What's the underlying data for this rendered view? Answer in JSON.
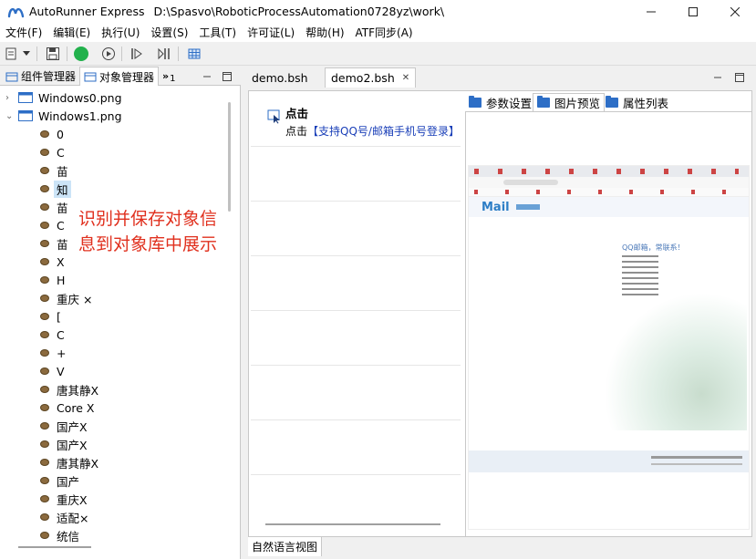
{
  "window": {
    "app_name": "AutoRunner Express",
    "path": "D:\\Spasvo\\RoboticProcessAutomation0728yz\\work\\"
  },
  "menu": [
    "文件(F)",
    "编辑(E)",
    "执行(U)",
    "设置(S)",
    "工具(T)",
    "许可证(L)",
    "帮助(H)",
    "ATF同步(A)"
  ],
  "left_panel": {
    "tabs": [
      "组件管理器",
      "对象管理器"
    ],
    "overflow_count": "1",
    "tree": {
      "roots": [
        "Windows0.png",
        "Windows1.png"
      ],
      "children": [
        "0",
        "C",
        "苗",
        "知",
        "苗",
        "C",
        "苗",
        "X",
        "H",
        "重庆 ×",
        "[",
        "C",
        "+",
        "V",
        "唐其静X",
        "Core X",
        "国产X",
        "国产X",
        "唐其静X",
        "国产",
        "重庆X",
        "适配×",
        "统信"
      ],
      "selected_index": 3
    },
    "annotation": "识别并保存对象信息到对象库中展示"
  },
  "editor": {
    "tabs": [
      "demo.bsh",
      "demo2.bsh"
    ],
    "active_tab": "demo2.bsh",
    "step": {
      "title": "点击",
      "desc_prefix": "点击",
      "desc_link": "【支持QQ号/邮箱手机号登录】"
    },
    "property_tabs": [
      "参数设置",
      "图片预览",
      "属性列表"
    ],
    "active_property_tab": "图片预览",
    "preview": {
      "brand": "Mail",
      "slogan": "QQ邮箱，常联系！"
    },
    "status_tab": "自然语言视图"
  },
  "colors": {
    "accent": "#2d6ec6",
    "annotation": "#e0301e",
    "link": "#1a3fb8",
    "run_green": "#22b14c"
  }
}
